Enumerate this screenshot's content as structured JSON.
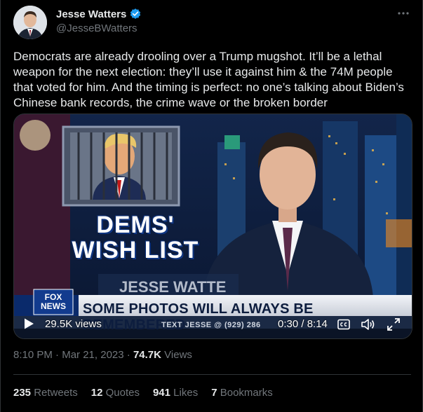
{
  "author": {
    "display_name": "Jesse Watters",
    "handle": "@JesseBWatters",
    "verified": true
  },
  "tweet": {
    "text": "Democrats are already drooling over a Trump mugshot. It’ll be a lethal weapon for the next election: they’ll use it against him & the 74M people that voted for him. And the timing is perfect: no one’s talking about Biden’s Chinese bank records, the crime wave or the broken border"
  },
  "media": {
    "graphic_title": "DEMS' WISH LIST",
    "nameplate": "JESSE WATTE",
    "logo_text": "FOX NEWS",
    "chyron": "SOME PHOTOS WILL ALWAYS BE REMEMBERED",
    "tagline": "TEXT JESSE @ (929) 286",
    "views_label": "29.5K views",
    "time_label": "0:30 / 8:14",
    "controls": {
      "play": "play-icon",
      "captions": "captions-icon",
      "volume": "volume-icon",
      "fullscreen": "fullscreen-icon"
    }
  },
  "meta": {
    "time": "8:10 PM",
    "date": "Mar 21, 2023",
    "separator": " · ",
    "views_count": "74.7K",
    "views_label": "Views"
  },
  "stats": [
    {
      "num": "235",
      "label": "Retweets"
    },
    {
      "num": "12",
      "label": "Quotes"
    },
    {
      "num": "941",
      "label": "Likes"
    },
    {
      "num": "7",
      "label": "Bookmarks"
    }
  ],
  "colors": {
    "background": "#000000",
    "text_primary": "#e7e9ea",
    "text_secondary": "#71767b",
    "verified_blue": "#1d9bf0",
    "border": "#2f3336"
  }
}
